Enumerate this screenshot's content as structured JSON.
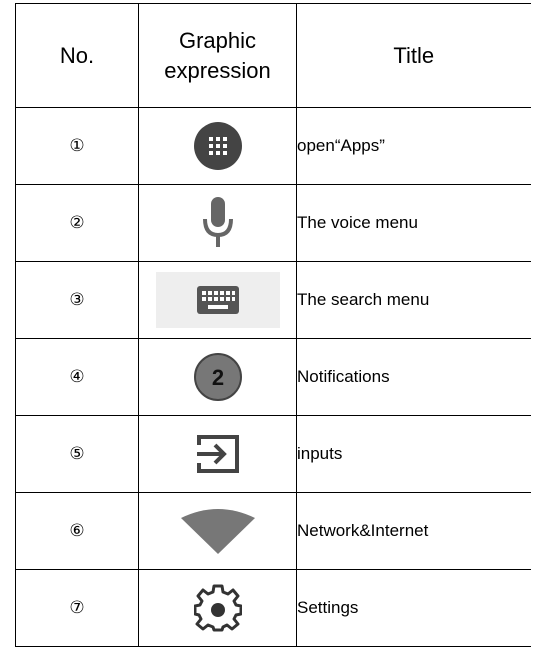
{
  "table": {
    "headers": {
      "no": "No.",
      "graphic_line1": "Graphic",
      "graphic_line2": "expression",
      "title": "Title"
    },
    "rows": [
      {
        "no": "①",
        "icon": "apps-grid-icon",
        "title": "open“Apps”"
      },
      {
        "no": "②",
        "icon": "microphone-icon",
        "title": "The voice menu"
      },
      {
        "no": "③",
        "icon": "keyboard-icon",
        "title": "The search menu"
      },
      {
        "no": "④",
        "icon": "notifications-badge-icon",
        "badge": "2",
        "title": "Notifications"
      },
      {
        "no": "⑤",
        "icon": "input-icon",
        "title": "inputs"
      },
      {
        "no": "⑥",
        "icon": "wifi-icon",
        "title": "Network&Internet"
      },
      {
        "no": "⑦",
        "icon": "settings-gear-icon",
        "title": "Settings"
      }
    ]
  },
  "colors": {
    "icon_dark": "#444444",
    "icon_grey": "#666666",
    "keyboard_bg": "#eeeeee"
  }
}
